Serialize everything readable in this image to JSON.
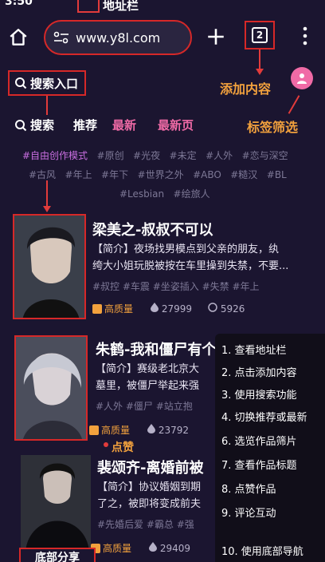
{
  "status_time": "3:50",
  "annotations": {
    "address": "地址栏",
    "add_content": "添加内容",
    "tag_filter": "标签筛选",
    "like": "点赞",
    "bottom_share": "底部分享"
  },
  "browser": {
    "url": "www.y8l.com",
    "tab_count": "2"
  },
  "search_entry": "搜索入口",
  "nav": {
    "search": "搜索",
    "recommend": "推荐",
    "latest": "最新",
    "latest_page": "最新页"
  },
  "tags": {
    "row1": [
      "#自由创作模式",
      "#原创",
      "#光夜",
      "#未定",
      "#人外",
      "#恋与深空"
    ],
    "row2": [
      "#古风",
      "#年上",
      "#年下",
      "#世界之外",
      "#ABO",
      "#糙汉",
      "#BL"
    ],
    "row3": [
      "#Lesbian",
      "#绘旅人"
    ]
  },
  "cards": [
    {
      "title": "梁美之-叔叔不可以",
      "intro_line1": "【简介】夜场找男模点到父亲的朋友，纨",
      "intro_line2": "绔大小姐玩脱被按在车里操到失禁，不要...",
      "tags": "#叔控  #车震  #坐姿插入  #失禁  #年上",
      "quality": "高质量",
      "likes": "27999",
      "comments": "5926"
    },
    {
      "title": "朱鹤-我和僵尸有个",
      "intro_line1": "【简介】赛级老北京大",
      "intro_line2": "墓里，被僵尸举起来强",
      "tags": "#人外  #僵尸  #站立抱",
      "quality": "高质量",
      "likes": "23792"
    },
    {
      "title": "裴颂齐-离婚前被",
      "intro_line1": "【简介】协议婚姻到期",
      "intro_line2": "了之，被即将变成前夫",
      "tags": "#先婚后爱  #霸总  #强",
      "quality": "高质量",
      "likes": "29409"
    }
  ],
  "steps": [
    "1. 查看地址栏",
    "2. 点击添加内容",
    "3. 使用搜索功能",
    "4. 切换推荐或最新",
    "6. 选览作品筛片",
    "7. 查看作品标题",
    "8. 点赞作品",
    "9. 评论互动",
    "10. 使用底部导航"
  ],
  "colors": {
    "accent_red": "#d62828",
    "accent_pink": "#f06aa6",
    "accent_orange": "#f2a13d",
    "background": "#1b1530"
  }
}
